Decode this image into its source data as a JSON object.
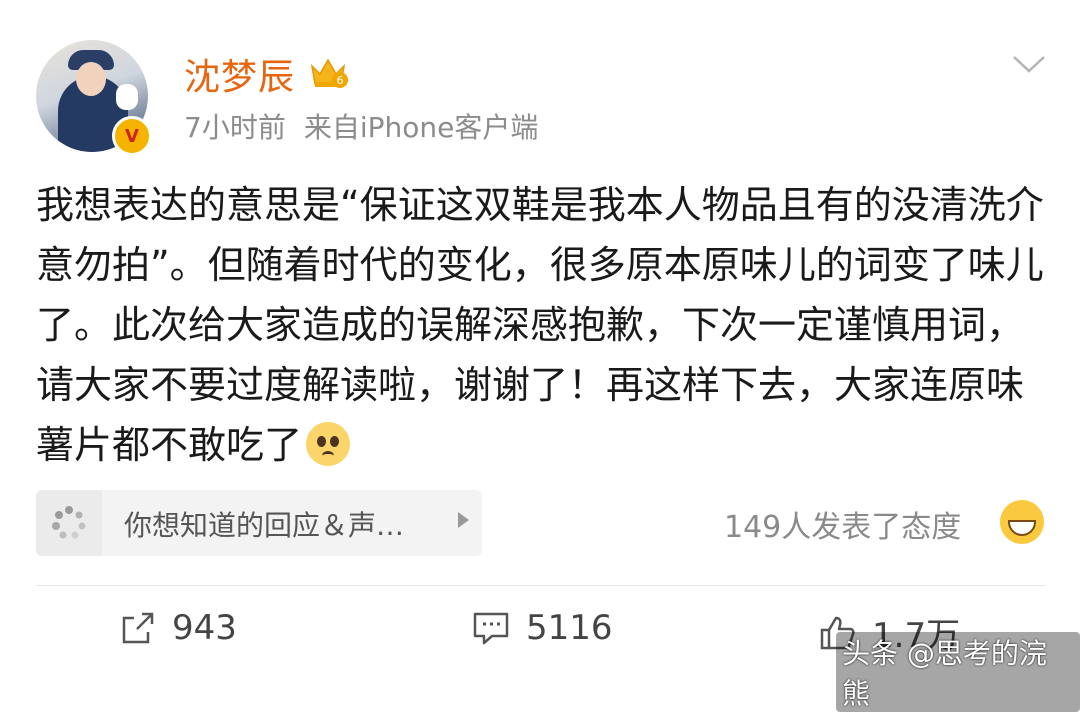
{
  "post": {
    "author": "沈梦辰",
    "time": "7小时前",
    "source": "来自iPhone客户端",
    "verified_badge": "V",
    "member_level": "6",
    "text": "我想表达的意思是“保证这双鞋是我本人物品且有的没清洗介意勿拍”。但随着时代的变化，很多原本原味儿的词变了味儿了。此次给大家造成的误解深感抱歉，下次一定谨慎用词，请大家不要过度解读啦，谢谢了！再这样下去，大家连原味薯片都不敢吃了"
  },
  "response_card": {
    "label": "你想知道的回应＆声…",
    "attitude": "149人发表了态度"
  },
  "actions": {
    "repost": "943",
    "comment": "5116",
    "like": "1.7万"
  },
  "watermark": "头条 @思考的浣熊",
  "colors": {
    "author": "#e8650f",
    "meta": "#8c8c8c",
    "badge": "#f6b400"
  }
}
